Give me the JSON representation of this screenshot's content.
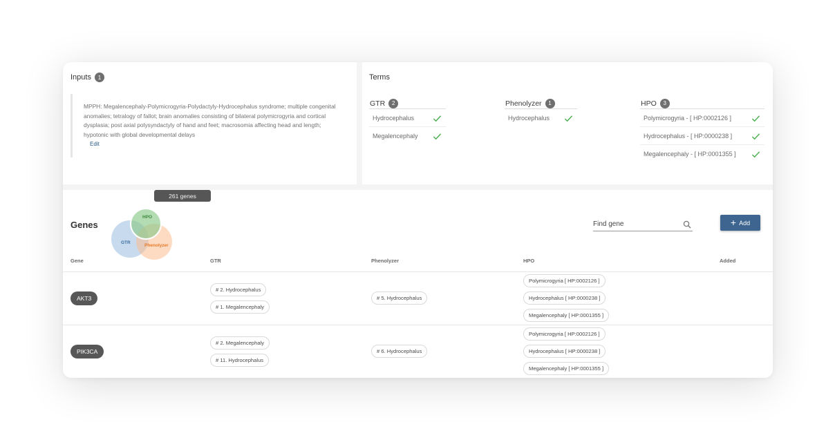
{
  "inputs": {
    "title": "Inputs",
    "count": "1",
    "text": "MPPH: Megalencephaly-Polymicrogyria-Polydactyly-Hydrocephalus syndrome; multiple congenital anomalies; tetralogy of fallot; brain anomalies consisting of bilateral polymicrogyria and cortical dysplasia; post axial polysyndactyly of hand and feet; macrosomia affecting head and length; hypotonic with global developmental delays",
    "edit_label": "Edit"
  },
  "terms": {
    "title": "Terms",
    "gtr": {
      "label": "GTR",
      "count": "2",
      "items": [
        "Hydrocephalus",
        "Megalencephaly"
      ]
    },
    "phenolyzer": {
      "label": "Phenolyzer",
      "count": "1",
      "items": [
        "Hydrocephalus"
      ]
    },
    "hpo": {
      "label": "HPO",
      "count": "3",
      "items": [
        "Polymicrogyria - [ HP:0002126 ]",
        "Hydrocephalus - [ HP:0000238 ]",
        "Megalencephaly - [ HP:0001355 ]"
      ]
    }
  },
  "genes": {
    "title": "Genes",
    "tooltip": "261 genes",
    "venn": {
      "hpo": "HPO",
      "gtr": "GTR",
      "phenolyzer": "Phenolyzer"
    },
    "find_placeholder": "Find gene",
    "add_label": "Add",
    "columns": [
      "Gene",
      "GTR",
      "Phenolyzer",
      "HPO",
      "Added"
    ],
    "rows": [
      {
        "gene": "AKT3",
        "gtr": [
          "# 2. Hydrocephalus",
          "# 1. Megalencephaly"
        ],
        "phenolyzer": [
          "# 5. Hydrocephalus"
        ],
        "hpo": [
          "Polymicrogyria [ HP:0002126 ]",
          "Hydrocephalus [ HP:0000238 ]",
          "Megalencephaly [ HP:0001355 ]"
        ]
      },
      {
        "gene": "PIK3CA",
        "gtr": [
          "# 2. Megalencephaly",
          "# 11. Hydrocephalus"
        ],
        "phenolyzer": [
          "# 6. Hydrocephalus"
        ],
        "hpo": [
          "Polymicrogyria [ HP:0002126 ]",
          "Hydrocephalus [ HP:0000238 ]",
          "Megalencephaly [ HP:0001355 ]"
        ]
      }
    ]
  },
  "colors": {
    "primary": "#3e6590",
    "check": "#4caf50",
    "venn_hpo": "#8cc98a",
    "venn_gtr": "#9bbcdf",
    "venn_phenolyzer": "#fbbd8f"
  }
}
